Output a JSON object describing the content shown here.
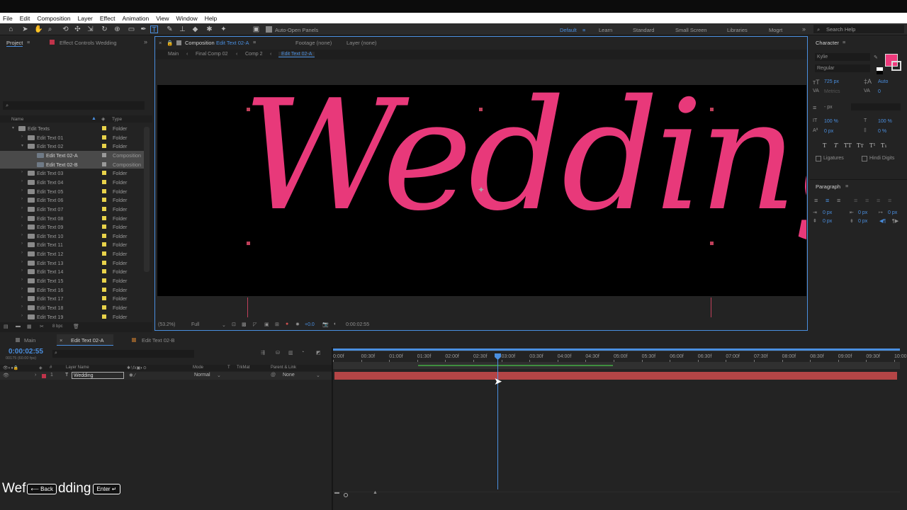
{
  "menu": [
    "File",
    "Edit",
    "Composition",
    "Layer",
    "Effect",
    "Animation",
    "View",
    "Window",
    "Help"
  ],
  "toolbar": {
    "auto_open": "Auto-Open Panels",
    "workspaces": [
      "Default",
      "Learn",
      "Standard",
      "Small Screen",
      "Libraries",
      "Mogrt"
    ],
    "search_help": "Search Help"
  },
  "project": {
    "tab": "Project",
    "effect_tab": "Effect Controls Wedding",
    "col_name": "Name",
    "col_type": "Type",
    "items": [
      {
        "name": "Edit Texts",
        "type": "Folder"
      },
      {
        "name": "Edit Text 01",
        "type": "Folder"
      },
      {
        "name": "Edit Text 02",
        "type": "Folder"
      },
      {
        "name": "Edit Text 02-A",
        "type": "Composition"
      },
      {
        "name": "Edit Text 02-B",
        "type": "Composition"
      },
      {
        "name": "Edit Text 03",
        "type": "Folder"
      },
      {
        "name": "Edit Text 04",
        "type": "Folder"
      },
      {
        "name": "Edit Text 05",
        "type": "Folder"
      },
      {
        "name": "Edit Text 06",
        "type": "Folder"
      },
      {
        "name": "Edit Text 07",
        "type": "Folder"
      },
      {
        "name": "Edit Text 08",
        "type": "Folder"
      },
      {
        "name": "Edit Text 09",
        "type": "Folder"
      },
      {
        "name": "Edit Text 10",
        "type": "Folder"
      },
      {
        "name": "Edit Text 11",
        "type": "Folder"
      },
      {
        "name": "Edit Text 12",
        "type": "Folder"
      },
      {
        "name": "Edit Text 13",
        "type": "Folder"
      },
      {
        "name": "Edit Text 14",
        "type": "Folder"
      },
      {
        "name": "Edit Text 15",
        "type": "Folder"
      },
      {
        "name": "Edit Text 16",
        "type": "Folder"
      },
      {
        "name": "Edit Text 17",
        "type": "Folder"
      },
      {
        "name": "Edit Text 18",
        "type": "Folder"
      },
      {
        "name": "Edit Text 19",
        "type": "Folder"
      }
    ],
    "bpc": "8 bpc"
  },
  "comp": {
    "tab_prefix": "Composition",
    "tab_name": "Edit Text 02-A",
    "footage": "Footage (none)",
    "layer": "Layer (none)",
    "breadcrumbs": [
      "Main",
      "Final Comp 02",
      "Comp 2",
      "Edit Text 02-A"
    ],
    "text": "Wedding",
    "zoom": "(53.2%)",
    "resolution": "Full",
    "exposure": "+0.0",
    "timecode": "0:00:02:55"
  },
  "character": {
    "title": "Character",
    "font": "Kylie",
    "style": "Regular",
    "size": "725 px",
    "leading": "Auto",
    "kerning": "Metrics",
    "tracking": "0",
    "stroke": "- px",
    "vscale": "100 %",
    "hscale": "100 %",
    "baseline": "0 px",
    "tsume": "0 %",
    "ligatures": "Ligatures",
    "hindi": "Hindi Digits",
    "fill_color": "#ee3a7c"
  },
  "paragraph": {
    "title": "Paragraph",
    "values": [
      "0 px",
      "0 px",
      "0 px",
      "0 px",
      "0 px"
    ]
  },
  "timeline": {
    "tabs": [
      "Main",
      "Edit Text 02-A",
      "Edit Text 02-B"
    ],
    "timecode": "0:00:02:55",
    "frames": "00175 (60.00 fps)",
    "cols": {
      "layer_name": "Layer Name",
      "mode": "Mode",
      "t": "T",
      "trkmat": "TrkMat",
      "parent": "Parent & Link"
    },
    "layer": {
      "num": "1",
      "name": "Wedding",
      "mode": "Normal",
      "parent": "None"
    },
    "ticks": [
      "0:00f",
      "00:30f",
      "01:00f",
      "01:30f",
      "02:00f",
      "02:30f",
      "03:00f",
      "03:30f",
      "04:00f",
      "04:30f",
      "05:00f",
      "05:30f",
      "06:00f",
      "06:30f",
      "07:00f",
      "07:30f",
      "08:00f",
      "08:30f",
      "09:00f",
      "09:30f",
      "10:00"
    ]
  },
  "keys": {
    "typed_a": "We",
    "typed_b": "f",
    "back": "Back",
    "typed_c": "dding",
    "enter": "Enter"
  }
}
